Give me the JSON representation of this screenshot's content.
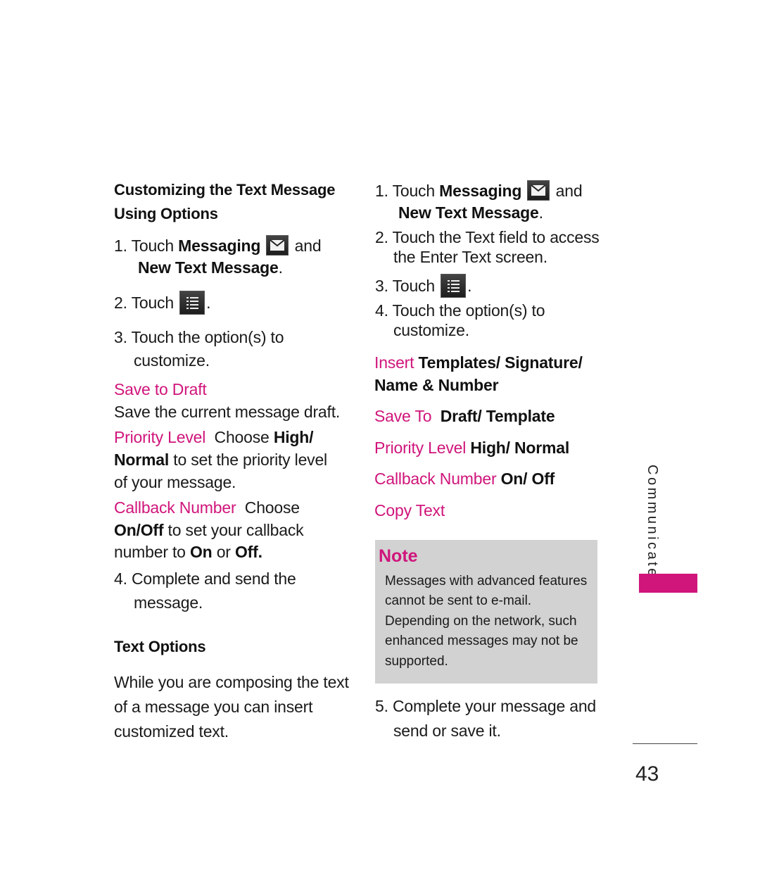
{
  "left": {
    "heading_line1": "Customizing the Text Message",
    "heading_line2": "Using Options",
    "step1": {
      "num": "1.",
      "touch": "Touch",
      "bold": "Messaging",
      "and": "and",
      "line2": "New Text Message",
      "period": "."
    },
    "step2": {
      "num": "2.",
      "touch": "Touch",
      "period": "."
    },
    "step3": {
      "line1": "3. Touch the option(s) to",
      "line2": "customize."
    },
    "save_draft": {
      "label": "Save to Draft",
      "desc": "Save the current message draft."
    },
    "priority": {
      "label": "Priority Level",
      "choose": "Choose",
      "high": "High/",
      "normal": "Normal",
      "rest": "to set the priority level",
      "line3": "of your message."
    },
    "callback": {
      "label": "Callback Number",
      "choose": "Choose",
      "onoff": "On/Off",
      "rest": "to set your callback",
      "l3a": "number to",
      "on": "On",
      "or": "or",
      "off": "Off."
    },
    "step4": {
      "line1": "4. Complete and send the",
      "line2": "message."
    },
    "text_options_heading": "Text Options",
    "text_options_body": [
      "While you are composing the text",
      "of a message you can insert",
      "customized text."
    ]
  },
  "right": {
    "step1": {
      "num": "1.",
      "touch": "Touch",
      "bold": "Messaging",
      "and": "and",
      "line2": "New Text Message",
      "period": "."
    },
    "step2": {
      "line1": "2. Touch the Text field to access",
      "line2": "the Enter Text screen."
    },
    "step3": {
      "num": "3.",
      "touch": "Touch",
      "period": "."
    },
    "step4": {
      "line1": "4. Touch the option(s) to",
      "line2": "customize."
    },
    "options": {
      "insert_label": "Insert",
      "insert_value": "Templates/ Signature/",
      "insert_value2": "Name & Number",
      "saveto_label": "Save To",
      "saveto_value": "Draft/ Template",
      "priority_label": "Priority Level",
      "priority_value": "High/ Normal",
      "callback_label": "Callback Number",
      "callback_value": "On/ Off",
      "copy_label": "Copy Text"
    },
    "note": {
      "title": "Note",
      "lines": [
        "Messages with advanced features",
        "cannot be sent to e-mail.",
        "Depending on the network, such",
        "enhanced messages may not be",
        "supported."
      ]
    },
    "step5": {
      "line1": "5. Complete your message and",
      "line2": "send or save it."
    }
  },
  "side_tab": {
    "label": "Communicate",
    "color": "#d0157b"
  },
  "page_number": "43",
  "colors": {
    "accent": "#d0157b",
    "note_bg": "#d2d2d2"
  },
  "icons": {
    "messaging": "envelope-icon",
    "menu": "menu-list-icon"
  }
}
